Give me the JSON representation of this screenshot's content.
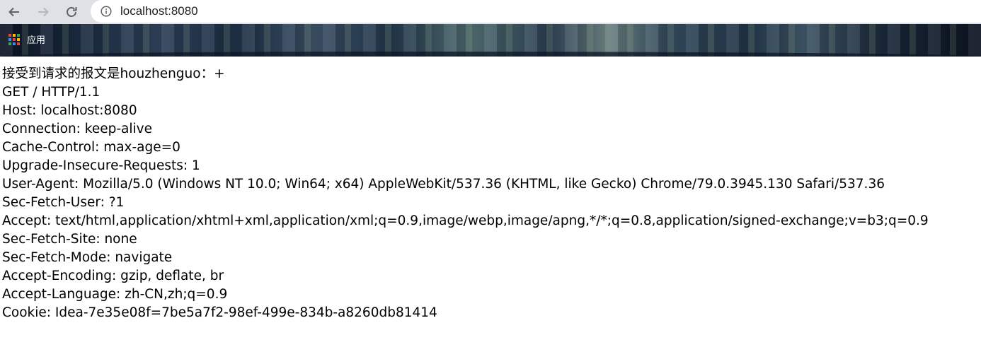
{
  "browser": {
    "url": "localhost:8080",
    "bookmarks_bar": {
      "apps_label": "应用"
    }
  },
  "page": {
    "heading": "接受到请求的报文是houzhenguo：+",
    "lines": [
      "GET / HTTP/1.1",
      "Host: localhost:8080",
      "Connection: keep-alive",
      "Cache-Control: max-age=0",
      "Upgrade-Insecure-Requests: 1",
      "User-Agent: Mozilla/5.0 (Windows NT 10.0; Win64; x64) AppleWebKit/537.36 (KHTML, like Gecko) Chrome/79.0.3945.130 Safari/537.36",
      "Sec-Fetch-User: ?1",
      "Accept: text/html,application/xhtml+xml,application/xml;q=0.9,image/webp,image/apng,*/*;q=0.8,application/signed-exchange;v=b3;q=0.9",
      "Sec-Fetch-Site: none",
      "Sec-Fetch-Mode: navigate",
      "Accept-Encoding: gzip, deflate, br",
      "Accept-Language: zh-CN,zh;q=0.9",
      "Cookie: Idea-7e35e08f=7be5a7f2-98ef-499e-834b-a8260db81414"
    ]
  },
  "colors": {
    "toolbar": "#dee1e6",
    "icon_disabled": "#9aa0a6",
    "icon_active": "#5f6368",
    "apps_grid": [
      "#ea4335",
      "#fbbc04",
      "#34a853",
      "#4285f4",
      "#ea4335",
      "#fbbc04",
      "#34a853",
      "#4285f4",
      "#ea4335"
    ]
  }
}
